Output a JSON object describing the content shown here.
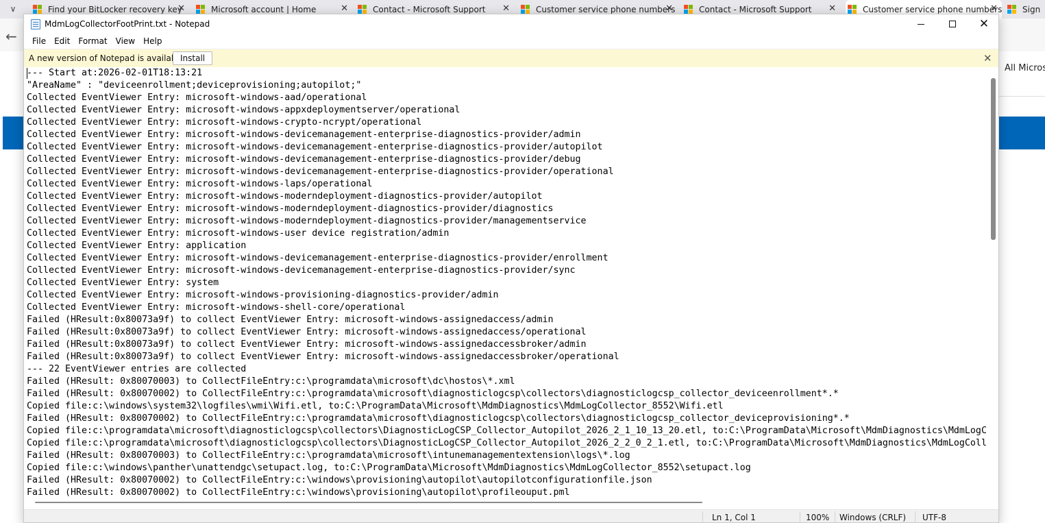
{
  "browser": {
    "tabs": [
      {
        "label": "Find your BitLocker recovery key"
      },
      {
        "label": "Microsoft account | Home"
      },
      {
        "label": "Contact - Microsoft Support"
      },
      {
        "label": "Customer service phone numbers"
      },
      {
        "label": "Contact - Microsoft Support"
      },
      {
        "label": "Customer service phone numbers"
      },
      {
        "label": "Sign"
      }
    ],
    "page_text": "All Microso"
  },
  "notepad": {
    "title": "MdmLogCollectorFootPrint.txt - Notepad",
    "menu": [
      "File",
      "Edit",
      "Format",
      "View",
      "Help"
    ],
    "infobar": {
      "message": "A new version of Notepad is available.",
      "button": "Install"
    },
    "lines": [
      "--- Start at:2026-02-01T18:13:21",
      "\"AreaName\" : \"deviceenrollment;deviceprovisioning;autopilot;\"",
      "Collected EventViewer Entry: microsoft-windows-aad/operational",
      "Collected EventViewer Entry: microsoft-windows-appxdeploymentserver/operational",
      "Collected EventViewer Entry: microsoft-windows-crypto-ncrypt/operational",
      "Collected EventViewer Entry: microsoft-windows-devicemanagement-enterprise-diagnostics-provider/admin",
      "Collected EventViewer Entry: microsoft-windows-devicemanagement-enterprise-diagnostics-provider/autopilot",
      "Collected EventViewer Entry: microsoft-windows-devicemanagement-enterprise-diagnostics-provider/debug",
      "Collected EventViewer Entry: microsoft-windows-devicemanagement-enterprise-diagnostics-provider/operational",
      "Collected EventViewer Entry: microsoft-windows-laps/operational",
      "Collected EventViewer Entry: microsoft-windows-moderndeployment-diagnostics-provider/autopilot",
      "Collected EventViewer Entry: microsoft-windows-moderndeployment-diagnostics-provider/diagnostics",
      "Collected EventViewer Entry: microsoft-windows-moderndeployment-diagnostics-provider/managementservice",
      "Collected EventViewer Entry: microsoft-windows-user device registration/admin",
      "Collected EventViewer Entry: application",
      "Collected EventViewer Entry: microsoft-windows-devicemanagement-enterprise-diagnostics-provider/enrollment",
      "Collected EventViewer Entry: microsoft-windows-devicemanagement-enterprise-diagnostics-provider/sync",
      "Collected EventViewer Entry: system",
      "Collected EventViewer Entry: microsoft-windows-provisioning-diagnostics-provider/admin",
      "Collected EventViewer Entry: microsoft-windows-shell-core/operational",
      "Failed (HResult:0x80073a9f) to collect EventViewer Entry: microsoft-windows-assignedaccess/admin",
      "Failed (HResult:0x80073a9f) to collect EventViewer Entry: microsoft-windows-assignedaccess/operational",
      "Failed (HResult:0x80073a9f) to collect EventViewer Entry: microsoft-windows-assignedaccessbroker/admin",
      "Failed (HResult:0x80073a9f) to collect EventViewer Entry: microsoft-windows-assignedaccessbroker/operational",
      "--- 22 EventViewer entries are collected",
      "Failed (HResult: 0x80070003) to CollectFileEntry:c:\\programdata\\microsoft\\dc\\hostos\\*.xml",
      "Failed (HResult: 0x80070002) to CollectFileEntry:c:\\programdata\\microsoft\\diagnosticlogcsp\\collectors\\diagnosticlogcsp_collector_deviceenrollment*.*",
      "Copied file:c:\\windows\\system32\\logfiles\\wmi\\Wifi.etl, to:C:\\ProgramData\\Microsoft\\MdmDiagnostics\\MdmLogCollector_8552\\Wifi.etl",
      "Failed (HResult: 0x80070002) to CollectFileEntry:c:\\programdata\\microsoft\\diagnosticlogcsp\\collectors\\diagnosticlogcsp_collector_deviceprovisioning*.*",
      "Copied file:c:\\programdata\\microsoft\\diagnosticlogcsp\\collectors\\DiagnosticLogCSP_Collector_Autopilot_2026_2_1_10_13_20.etl, to:C:\\ProgramData\\Microsoft\\MdmDiagnostics\\MdmLogC",
      "Copied file:c:\\programdata\\microsoft\\diagnosticlogcsp\\collectors\\DiagnosticLogCSP_Collector_Autopilot_2026_2_2_0_2_1.etl, to:C:\\ProgramData\\Microsoft\\MdmDiagnostics\\MdmLogColl",
      "Failed (HResult: 0x80070003) to CollectFileEntry:c:\\programdata\\microsoft\\intunemanagementextension\\logs\\*.log",
      "Copied file:c:\\windows\\panther\\unattendgc\\setupact.log, to:C:\\ProgramData\\Microsoft\\MdmDiagnostics\\MdmLogCollector_8552\\setupact.log",
      "Failed (HResult: 0x80070002) to CollectFileEntry:c:\\windows\\provisioning\\autopilot\\autopilotconfigurationfile.json",
      "Failed (HResult: 0x80070002) to CollectFileEntry:c:\\windows\\provisioning\\autopilot\\profileouput.pml"
    ],
    "status": {
      "position": "Ln 1, Col 1",
      "zoom": "100%",
      "line_ending": "Windows (CRLF)",
      "encoding": "UTF-8"
    }
  }
}
